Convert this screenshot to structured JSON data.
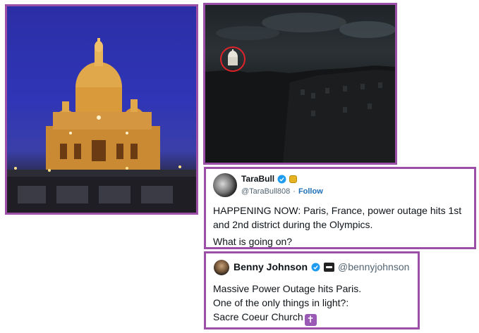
{
  "tweet1": {
    "display_name": "TaraBull",
    "handle": "@TaraBull808",
    "separator": "·",
    "follow_label": "Follow",
    "text_line1": "HAPPENING NOW: Paris, France, power outage hits 1st and 2nd district during the Olympics.",
    "text_line2": "What is going on?",
    "verified_icon": "verified-checkmark-icon",
    "badge_color": "#e6b422"
  },
  "tweet2": {
    "display_name": "Benny Johnson",
    "handle": "@bennyjohnson",
    "line1": "Massive Power Outage hits Paris.",
    "line2": "One of the only things in light?:",
    "line3": "Sacre Coeur Church",
    "emoji": "✝",
    "verified_icon": "verified-checkmark-icon",
    "emoji_color": "#9b59b6"
  },
  "colors": {
    "frame_border": "#9c4fa6",
    "verified_blue": "#1d9bf0",
    "follow_blue": "#1d6fb8",
    "highlight_circle": "#e0222a"
  }
}
